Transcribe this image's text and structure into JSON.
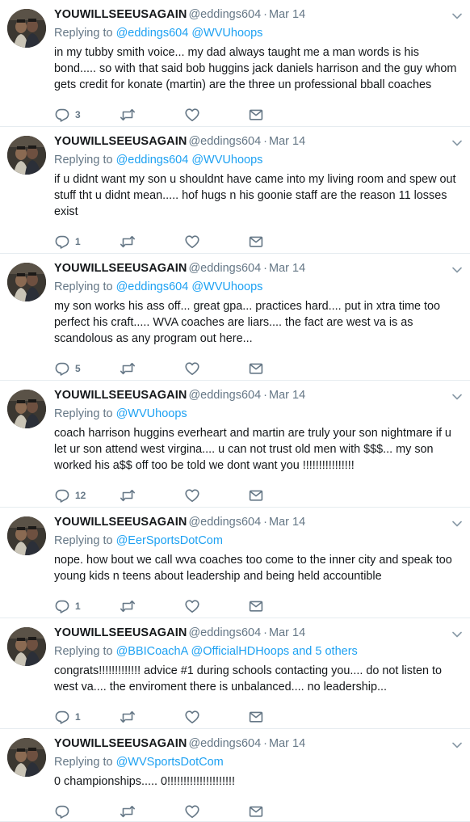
{
  "tweets": [
    {
      "name": "YOUWILLSEEUSAGAIN",
      "handle": "@eddings604",
      "sep": "·",
      "date": "Mar 14",
      "reply_prefix": "Replying to ",
      "reply_links": [
        "@eddings604",
        "@WVUhoops"
      ],
      "reply_suffix": "",
      "text": "in my tubby smith voice... my dad always taught me a man words is his bond..... so with that said bob huggins jack daniels harrison and the guy whom gets credit for konate (martin) are the three un professional bball coaches",
      "replies": "3",
      "retweets": "",
      "likes": ""
    },
    {
      "name": "YOUWILLSEEUSAGAIN",
      "handle": "@eddings604",
      "sep": "·",
      "date": "Mar 14",
      "reply_prefix": "Replying to ",
      "reply_links": [
        "@eddings604",
        "@WVUhoops"
      ],
      "reply_suffix": "",
      "text": "if u didnt want my son u shouldnt have came into my living room and spew out stuff tht u didnt mean..... hof hugs n his goonie staff are the reason 11 losses exist",
      "replies": "1",
      "retweets": "",
      "likes": ""
    },
    {
      "name": "YOUWILLSEEUSAGAIN",
      "handle": "@eddings604",
      "sep": "·",
      "date": "Mar 14",
      "reply_prefix": "Replying to ",
      "reply_links": [
        "@eddings604",
        "@WVUhoops"
      ],
      "reply_suffix": "",
      "text": "my son works his ass off... great gpa... practices hard.... put in xtra time too perfect his craft..... WVA coaches are liars.... the fact are west va is as scandolous as any program out here...",
      "replies": "5",
      "retweets": "",
      "likes": ""
    },
    {
      "name": "YOUWILLSEEUSAGAIN",
      "handle": "@eddings604",
      "sep": "·",
      "date": "Mar 14",
      "reply_prefix": "Replying to ",
      "reply_links": [
        "@WVUhoops"
      ],
      "reply_suffix": "",
      "text": "coach harrison huggins everheart and martin are truly your son nightmare if u let ur son attend west virgina.... u can not trust old men with $$$... my son worked his a$$ off too be told we dont want you !!!!!!!!!!!!!!!!",
      "replies": "12",
      "retweets": "",
      "likes": ""
    },
    {
      "name": "YOUWILLSEEUSAGAIN",
      "handle": "@eddings604",
      "sep": "·",
      "date": "Mar 14",
      "reply_prefix": "Replying to ",
      "reply_links": [
        "@EerSportsDotCom"
      ],
      "reply_suffix": "",
      "text": "nope. how bout we call wva coaches too come to the inner city and speak too young kids n teens about leadership and being held accountible",
      "replies": "1",
      "retweets": "",
      "likes": ""
    },
    {
      "name": "YOUWILLSEEUSAGAIN",
      "handle": "@eddings604",
      "sep": "·",
      "date": "Mar 14",
      "reply_prefix": "Replying to ",
      "reply_links": [
        "@BBICoachA",
        "@OfficialHDHoops",
        "and 5 others"
      ],
      "reply_suffix": "",
      "text": "congrats!!!!!!!!!!!!! advice #1 during schools contacting you.... do not listen to west va....  the enviroment there is unbalanced.... no leadership...",
      "replies": "1",
      "retweets": "",
      "likes": ""
    },
    {
      "name": "YOUWILLSEEUSAGAIN",
      "handle": "@eddings604",
      "sep": "·",
      "date": "Mar 14",
      "reply_prefix": "Replying to ",
      "reply_links": [
        "@WVSportsDotCom"
      ],
      "reply_suffix": "",
      "text": "0 championships..... 0!!!!!!!!!!!!!!!!!!!!!",
      "replies": "",
      "retweets": "",
      "likes": ""
    }
  ],
  "icons": {
    "reply": "reply-icon",
    "retweet": "retweet-icon",
    "like": "heart-icon",
    "message": "envelope-icon",
    "more": "chevron-down-icon"
  },
  "colors": {
    "link": "#1da1f2",
    "secondary": "#657786",
    "text": "#14171a",
    "divider": "#e6ecf0"
  }
}
